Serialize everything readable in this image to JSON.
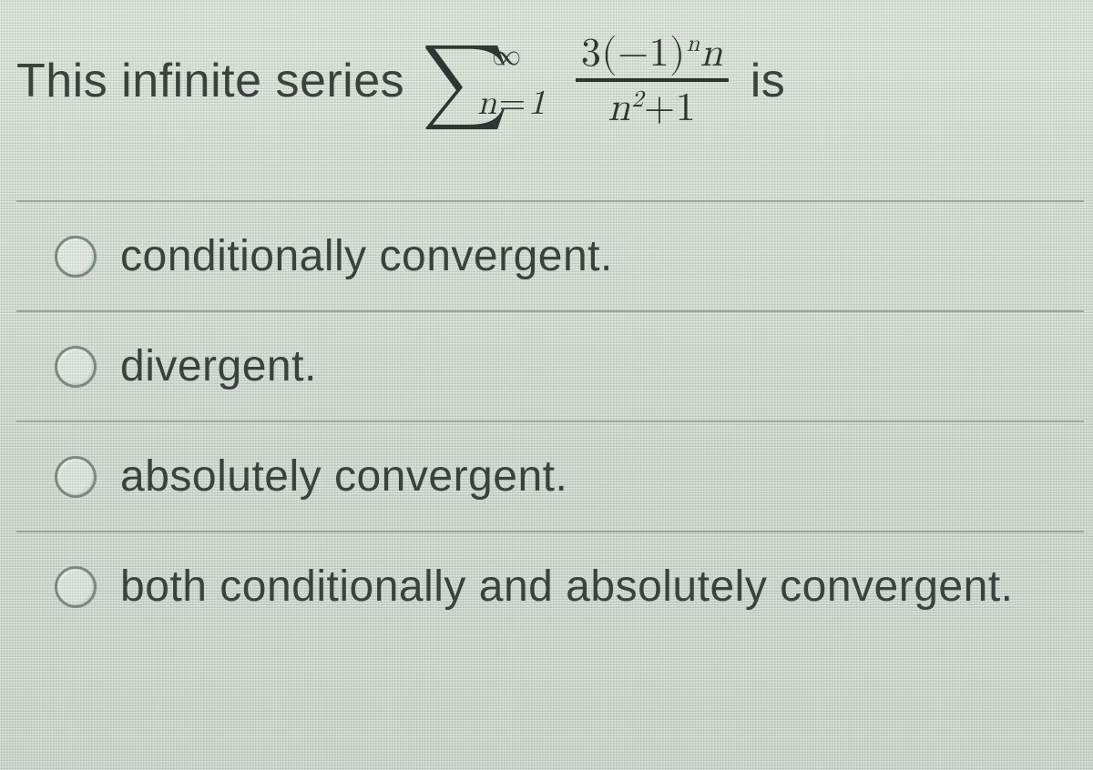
{
  "question": {
    "lead": "This infinite series",
    "trail": "is",
    "math": {
      "sigma_symbol": "∑",
      "upper_limit": "∞",
      "lower_var": "n",
      "lower_eq": "=",
      "lower_val": "1",
      "numerator": {
        "coef": "3",
        "open": "(",
        "base": "−1",
        "close": ")",
        "exp": "n",
        "mult_var": "n"
      },
      "denominator": {
        "var": "n",
        "exp": "2",
        "plus": "+",
        "one": "1"
      }
    }
  },
  "options": [
    {
      "label": "conditionally convergent."
    },
    {
      "label": "divergent."
    },
    {
      "label": "absolutely convergent."
    },
    {
      "label": "both conditionally and absolutely convergent."
    }
  ]
}
